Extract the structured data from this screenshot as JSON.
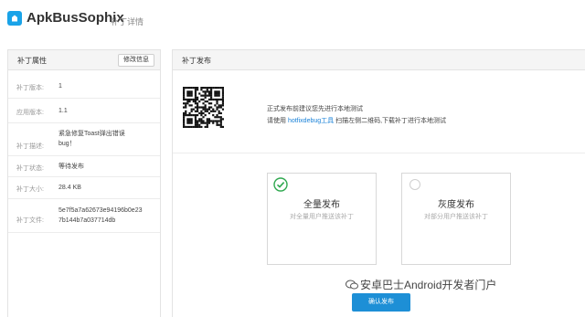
{
  "app": {
    "title": "ApkBusSophix",
    "subtitle": "补丁详情"
  },
  "left_panel": {
    "title": "补丁属性",
    "edit_button": "修改信息",
    "rows": [
      {
        "label": "补丁版本:",
        "value": "1"
      },
      {
        "label": "应用版本:",
        "value": "1.1"
      },
      {
        "label": "补丁描述:",
        "value": "紧急修复Toast弹出错误bug！"
      },
      {
        "label": "补丁状态:",
        "value": "等待发布"
      },
      {
        "label": "补丁大小:",
        "value": "28.4 KB"
      },
      {
        "label": "补丁文件:",
        "value": "5e7f5a7a62673e94196b0e237b144b7a037714db"
      }
    ]
  },
  "right_panel": {
    "title": "补丁发布",
    "notice_line1": "正式发布前建议您先进行本地测试",
    "notice_line2_prefix": "请使用",
    "notice_link": "hotfixdebug工具",
    "notice_line2_suffix": "扫描左侧二维码,下载补丁进行本地测试",
    "options": [
      {
        "title": "全量发布",
        "desc": "对全量用户推送该补丁",
        "selected": true
      },
      {
        "title": "灰度发布",
        "desc": "对部分用户推送该补丁",
        "selected": false
      }
    ],
    "confirm_button": "确认发布"
  },
  "watermark": {
    "text": "安卓巴士Android开发者门户",
    "icon": "wechat-icon"
  },
  "colors": {
    "accent": "#1d8fd6",
    "link": "#1a82d8",
    "check": "#2fa84f"
  }
}
